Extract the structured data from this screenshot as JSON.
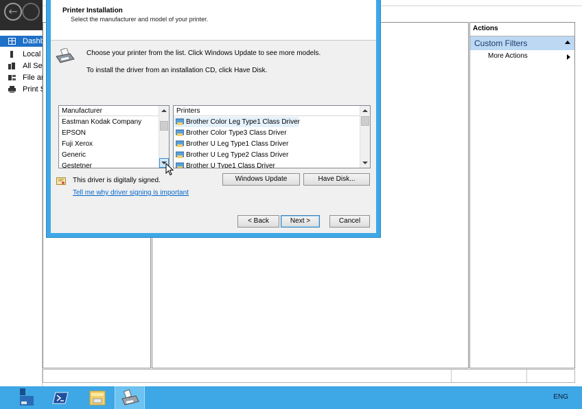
{
  "server_manager": {
    "sidebar": {
      "items": [
        {
          "label": "Dashboard",
          "active": true,
          "icon": "dashboard-icon"
        },
        {
          "label": "Local Server",
          "active": false,
          "icon": "local-server-icon"
        },
        {
          "label": "All Servers",
          "active": false,
          "icon": "all-servers-icon"
        },
        {
          "label": "File and Storage Services",
          "active": false,
          "icon": "file-storage-icon"
        },
        {
          "label": "Print Services",
          "active": false,
          "icon": "print-services-icon"
        }
      ]
    },
    "actions": {
      "title": "Actions",
      "custom_filters": "Custom Filters",
      "more_actions": "More Actions"
    }
  },
  "dialog": {
    "title": "Printer Installation",
    "subtitle": "Select the manufacturer and model of your printer.",
    "intro_line1": "Choose your printer from the list. Click Windows Update to see more models.",
    "intro_line2": "To install the driver from an installation CD, click Have Disk.",
    "manufacturer_header": "Manufacturer",
    "manufacturers": [
      "Eastman Kodak Company",
      "EPSON",
      "Fuji Xerox",
      "Generic",
      "Gestetner"
    ],
    "printers_header": "Printers",
    "printers": [
      "Brother Color Leg Type1 Class Driver",
      "Brother Color Type3 Class Driver",
      "Brother U Leg Type1 Class Driver",
      "Brother U Leg Type2 Class Driver",
      "Brother U Type1 Class Driver"
    ],
    "selected_printer_index": 0,
    "windows_update_label": "Windows Update",
    "have_disk_label": "Have Disk...",
    "signed_text": "This driver is digitally signed.",
    "signing_link": "Tell me why driver signing is important",
    "back_label": "< Back",
    "next_label": "Next >",
    "cancel_label": "Cancel"
  },
  "taskbar": {
    "items": [
      "server-manager-icon",
      "powershell-icon",
      "file-explorer-icon",
      "add-printer-wizard-icon"
    ],
    "active_index": 3,
    "language": "ENG"
  },
  "colors": {
    "accent": "#3ea7e6",
    "sidebar_active": "#1e70c8",
    "link": "#0066cc",
    "selection": "#bcd8f3"
  }
}
